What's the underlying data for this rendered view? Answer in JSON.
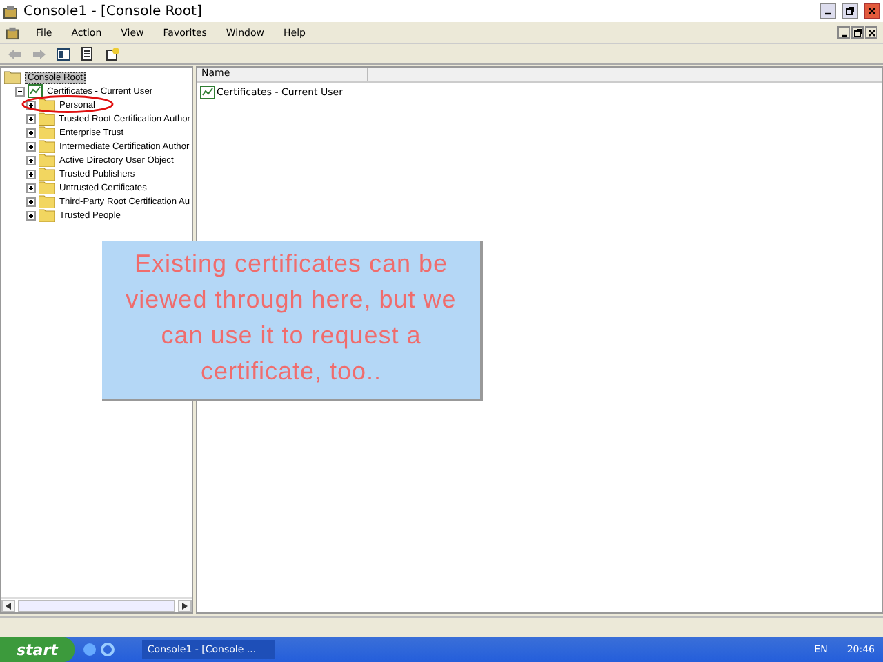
{
  "window": {
    "title": "Console1 - [Console Root]"
  },
  "menu": [
    "File",
    "Action",
    "View",
    "Favorites",
    "Window",
    "Help"
  ],
  "tree": [
    {
      "label": "Console Root",
      "selected": true,
      "kind": "root",
      "children": [
        {
          "label": "Certificates - Current User",
          "selected": false,
          "expanded": true,
          "kind": "store",
          "children": [
            {
              "label": "Personal",
              "selected": false,
              "expanded": false,
              "kind": "folder"
            },
            {
              "label": "Trusted Root Certification Author",
              "selected": false,
              "expanded": false,
              "kind": "folder"
            },
            {
              "label": "Enterprise Trust",
              "selected": false,
              "expanded": false,
              "kind": "folder"
            },
            {
              "label": "Intermediate Certification Author",
              "selected": false,
              "expanded": false,
              "kind": "folder"
            },
            {
              "label": "Active Directory User Object",
              "selected": false,
              "expanded": false,
              "kind": "folder"
            },
            {
              "label": "Trusted Publishers",
              "selected": false,
              "expanded": false,
              "kind": "folder"
            },
            {
              "label": "Untrusted Certificates",
              "selected": false,
              "expanded": false,
              "kind": "folder"
            },
            {
              "label": "Third-Party Root Certification Au",
              "selected": false,
              "expanded": false,
              "kind": "folder"
            },
            {
              "label": "Trusted People",
              "selected": false,
              "expanded": false,
              "kind": "folder"
            }
          ]
        }
      ]
    }
  ],
  "list": {
    "columns": [
      "Name"
    ],
    "rows": [
      "Certificates - Current User"
    ]
  },
  "callout": "Existing certificates can be viewed through here, but we can use it to request a certificate, too..",
  "taskbar": {
    "start": "start",
    "task": "Console1 - [Console ...",
    "language": "EN",
    "clock": "20:46"
  }
}
